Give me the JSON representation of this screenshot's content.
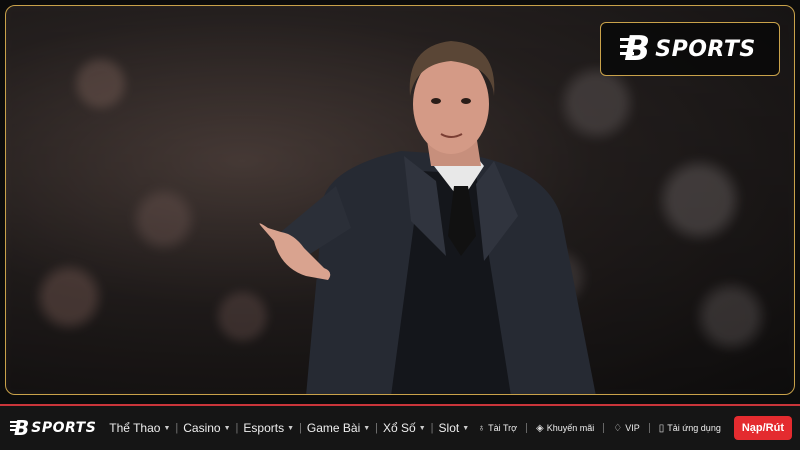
{
  "watermark": {
    "brand_b": "B",
    "brand_text": "SPORTS"
  },
  "navbar": {
    "logo_b": "B",
    "logo_text": "SPORTS",
    "items": [
      {
        "label": "Thể Thao"
      },
      {
        "label": "Casino"
      },
      {
        "label": "Esports"
      },
      {
        "label": "Game Bài"
      },
      {
        "label": "Xổ Số"
      },
      {
        "label": "Slot"
      }
    ],
    "right": {
      "sponsor": "Tài Trợ",
      "promo": "Khuyến mãi",
      "vip": "VIP",
      "app": "Tải ứng dụng",
      "deposit": "Nạp/Rút"
    }
  },
  "colors": {
    "gold": "#c9a24a",
    "red": "#e42b2f",
    "bar": "#151515"
  }
}
